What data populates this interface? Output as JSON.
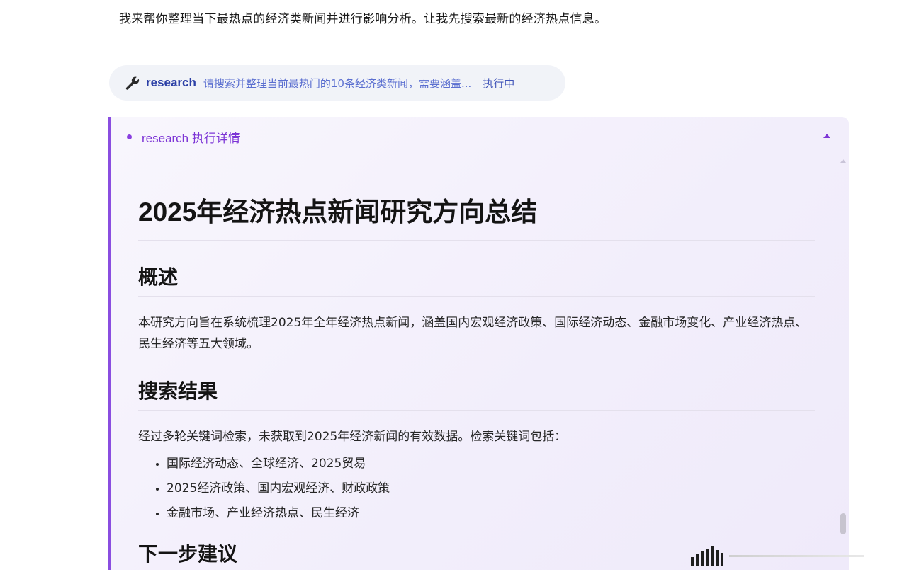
{
  "intro": {
    "text": "我来帮你整理当下最热点的经济类新闻并进行影响分析。让我先搜索最新的经济热点信息。"
  },
  "tool_call": {
    "icon": "wrench-icon",
    "name": "research",
    "query": "请搜索并整理当前最热门的10条经济类新闻，需要涵盖...",
    "status": "执行中"
  },
  "panel": {
    "header": "research 执行详情",
    "accent_color": "#8a4ee0",
    "collapse_icon": "caret-up-icon"
  },
  "doc": {
    "title": "2025年经济热点新闻研究方向总结",
    "overview_heading": "概述",
    "overview_text": "本研究方向旨在系统梳理2025年全年经济热点新闻，涵盖国内宏观经济政策、国际经济动态、金融市场变化、产业经济热点、民生经济等五大领域。",
    "results_heading": "搜索结果",
    "results_text": "经过多轮关键词检索，未获取到2025年经济新闻的有效数据。检索关键词包括：",
    "keywords": [
      "国际经济动态、全球经济、2025贸易",
      "2025经济政策、国内宏观经济、财政政策",
      "金融市场、产业经济热点、民生经济"
    ],
    "next_heading": "下一步建议"
  }
}
